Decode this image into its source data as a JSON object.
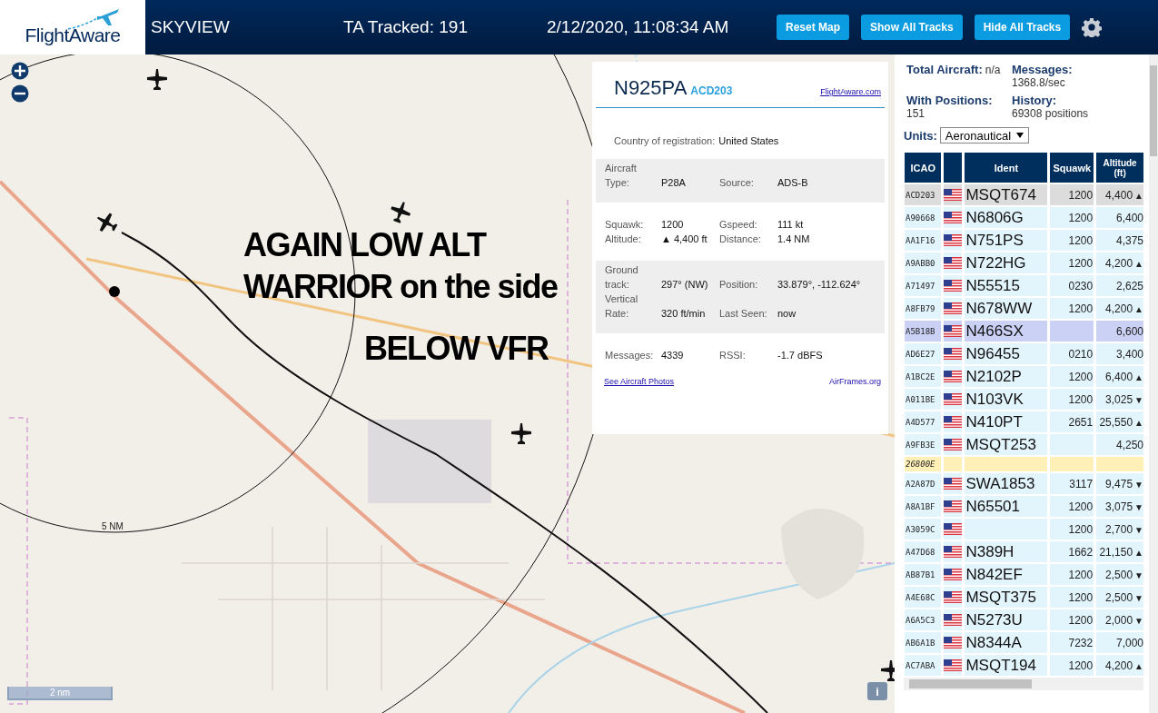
{
  "header": {
    "logo": "FlightAware",
    "title": "SKYVIEW",
    "tracked": "TA Tracked: 191",
    "datetime": "2/12/2020, 11:08:34 AM",
    "buttons": [
      "Reset Map",
      "Show All Tracks",
      "Hide All Tracks"
    ]
  },
  "map": {
    "range_label": "5 NM",
    "scale": "2 nm",
    "info_button": "i",
    "annotations": [
      "AGAIN LOW ALT",
      "WARRIOR on the side",
      "BELOW VFR"
    ]
  },
  "aircraft_panel": {
    "registration": "N925PA",
    "icao": "ACD203",
    "link": "FlightAware.com",
    "country_label": "Country of registration:",
    "country": "United States",
    "sections": [
      {
        "shaded": true,
        "fields": [
          {
            "label": "Aircraft Type:",
            "value": "P28A"
          },
          {
            "label": "Source:",
            "value": "ADS-B"
          }
        ]
      },
      {
        "shaded": false,
        "fields": [
          {
            "label": "Squawk:",
            "value": "1200"
          },
          {
            "label": "Gspeed:",
            "value": "111 kt"
          },
          {
            "label": "Altitude:",
            "value": "▲ 4,400 ft"
          },
          {
            "label": "Distance:",
            "value": "1.4 NM"
          }
        ]
      },
      {
        "shaded": true,
        "fields": [
          {
            "label": "Ground track:",
            "value": "297° (NW)"
          },
          {
            "label": "Position:",
            "value": "33.879°, -112.624°"
          },
          {
            "label": "Vertical Rate:",
            "value": "320 ft/min"
          },
          {
            "label": "Last Seen:",
            "value": "now"
          }
        ]
      },
      {
        "shaded": false,
        "fields": [
          {
            "label": "Messages:",
            "value": "4339"
          },
          {
            "label": "RSSI:",
            "value": "-1.7 dBFS"
          }
        ]
      }
    ],
    "photos_link": "See Aircraft Photos",
    "airframes_link": "AirFrames.org"
  },
  "stats": [
    {
      "label": "Total Aircraft:",
      "value": "n/a"
    },
    {
      "label": "Messages:",
      "value": "1368.8/sec"
    },
    {
      "label": "With Positions:",
      "value": "151"
    },
    {
      "label": "History:",
      "value": "69308 positions"
    }
  ],
  "units": {
    "label": "Units:",
    "value": "Aeronautical"
  },
  "table": {
    "columns": [
      "ICAO",
      "Ident",
      "Squawk",
      "Altitude (ft)"
    ],
    "rows": [
      {
        "icao": "ACD203",
        "flag": true,
        "ident": "MSQT674",
        "squawk": "1200",
        "altitude": "4,400",
        "trend": "▲",
        "selected": true,
        "kind": "adsb"
      },
      {
        "icao": "A90668",
        "flag": true,
        "ident": "N6806G",
        "squawk": "1200",
        "altitude": "6,400",
        "selected": false,
        "kind": "adsb"
      },
      {
        "icao": "AA1F16",
        "flag": true,
        "ident": "N751PS",
        "squawk": "1200",
        "altitude": "4,375",
        "selected": false,
        "kind": "adsb"
      },
      {
        "icao": "A9ABB0",
        "flag": true,
        "ident": "N722HG",
        "squawk": "1200",
        "altitude": "4,200",
        "trend": "▲",
        "selected": false,
        "kind": "adsb"
      },
      {
        "icao": "A71497",
        "flag": true,
        "ident": "N55515",
        "squawk": "0230",
        "altitude": "2,625",
        "selected": false,
        "kind": "adsb"
      },
      {
        "icao": "A8FB79",
        "flag": true,
        "ident": "N678WW",
        "squawk": "1200",
        "altitude": "4,200",
        "trend": "▲",
        "selected": false,
        "kind": "adsb"
      },
      {
        "icao": "A5B18B",
        "flag": true,
        "ident": "N466SX",
        "altitude": "6,600",
        "selected": false,
        "kind": "mlat"
      },
      {
        "icao": "AD6E27",
        "flag": true,
        "ident": "N96455",
        "squawk": "0210",
        "altitude": "3,400",
        "selected": false,
        "kind": "adsb"
      },
      {
        "icao": "A1BC2E",
        "flag": true,
        "ident": "N2102P",
        "squawk": "1200",
        "altitude": "6,400",
        "trend": "▲",
        "selected": false,
        "kind": "adsb"
      },
      {
        "icao": "A011BE",
        "flag": true,
        "ident": "N103VK",
        "squawk": "1200",
        "altitude": "3,025",
        "trend": "▼",
        "selected": false,
        "kind": "adsb"
      },
      {
        "icao": "A4D577",
        "flag": true,
        "ident": "N410PT",
        "squawk": "2651",
        "altitude": "25,550",
        "trend": "▲",
        "selected": false,
        "kind": "adsb"
      },
      {
        "icao": "A9FB3E",
        "flag": true,
        "ident": "MSQT253",
        "altitude": "4,250",
        "selected": false,
        "kind": "adsb"
      },
      {
        "icao": "26800E",
        "flag": false,
        "selected": false,
        "kind": "other"
      },
      {
        "icao": "A2A87D",
        "flag": true,
        "ident": "SWA1853",
        "squawk": "3117",
        "altitude": "9,475",
        "trend": "▼",
        "selected": false,
        "kind": "adsb"
      },
      {
        "icao": "A8A1BF",
        "flag": true,
        "ident": "N65501",
        "squawk": "1200",
        "altitude": "3,075",
        "trend": "▼",
        "selected": false,
        "kind": "adsb"
      },
      {
        "icao": "A3059C",
        "flag": true,
        "squawk": "1200",
        "altitude": "2,700",
        "trend": "▼",
        "selected": false,
        "kind": "adsb"
      },
      {
        "icao": "A47D68",
        "flag": true,
        "ident": "N389H",
        "squawk": "1662",
        "altitude": "21,150",
        "trend": "▲",
        "selected": false,
        "kind": "adsb"
      },
      {
        "icao": "AB87B1",
        "flag": true,
        "ident": "N842EF",
        "squawk": "1200",
        "altitude": "2,500",
        "trend": "▼",
        "selected": false,
        "kind": "adsb"
      },
      {
        "icao": "A4E68C",
        "flag": true,
        "ident": "MSQT375",
        "squawk": "1200",
        "altitude": "2,500",
        "trend": "▼",
        "selected": false,
        "kind": "adsb"
      },
      {
        "icao": "A6A5C3",
        "flag": true,
        "ident": "N5273U",
        "squawk": "1200",
        "altitude": "2,000",
        "trend": "▼",
        "selected": false,
        "kind": "adsb"
      },
      {
        "icao": "AB6A1B",
        "flag": true,
        "ident": "N8344A",
        "squawk": "7232",
        "altitude": "7,000",
        "selected": false,
        "kind": "adsb"
      },
      {
        "icao": "AC7ABA",
        "flag": true,
        "ident": "MSQT194",
        "squawk": "1200",
        "altitude": "4,200",
        "trend": "▲",
        "selected": false,
        "kind": "adsb"
      }
    ]
  }
}
